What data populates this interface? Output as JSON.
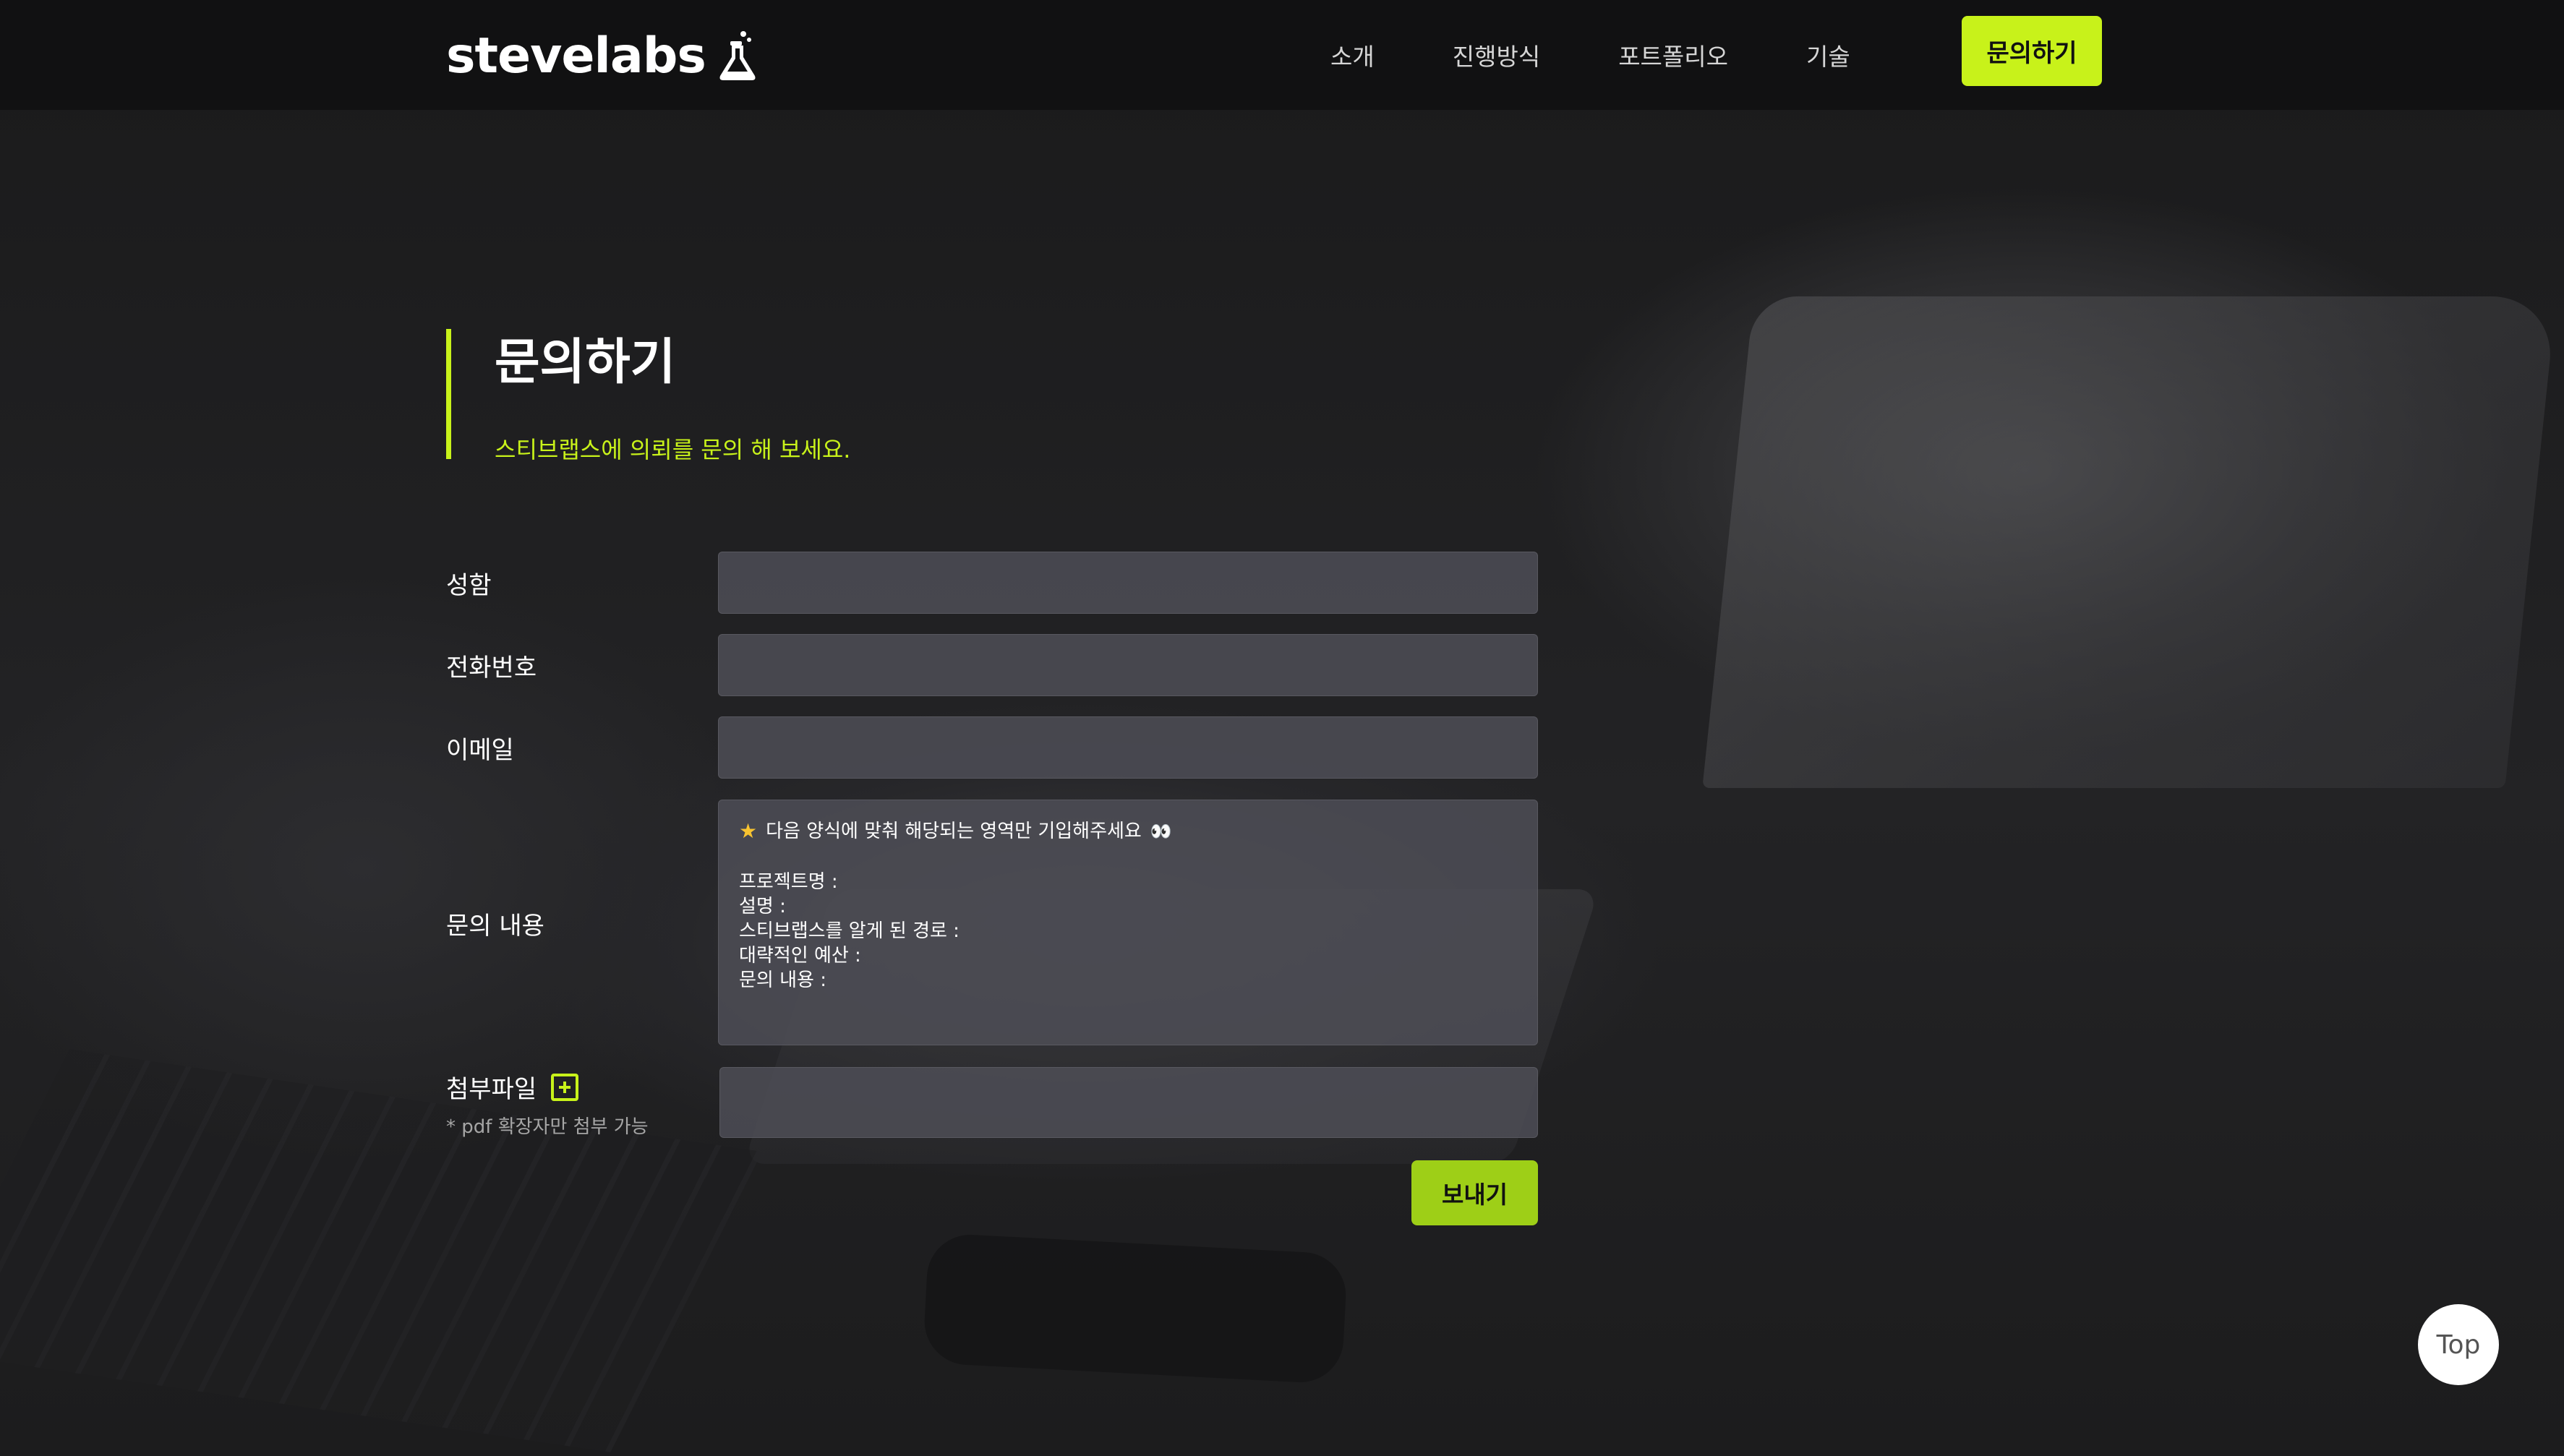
{
  "header": {
    "logo_text": "stevelabs",
    "logo_icon": "flask-icon",
    "nav": [
      "소개",
      "진행방식",
      "포트폴리오",
      "기술"
    ],
    "cta_label": "문의하기"
  },
  "hero": {
    "title": "문의하기",
    "subtitle": "스티브랩스에 의뢰를 문의 해 보세요."
  },
  "form": {
    "name_label": "성함",
    "phone_label": "전화번호",
    "email_label": "이메일",
    "content_label": "문의 내용",
    "content_template": {
      "heading": "다음 양식에 맞춰 해당되는 영역만 기입해주세요",
      "lines": [
        "프로젝트명 :",
        "설명 :",
        "스티브랩스를 알게 된 경로 :",
        "대략적인 예산 :",
        "문의 내용 :"
      ]
    },
    "file_label": "첨부파일",
    "file_note": "* pdf 확장자만 첨부 가능",
    "submit_label": "보내기"
  },
  "top_button_label": "Top",
  "colors": {
    "accent": "#c8f21a",
    "submit": "#9ecf17",
    "header_bg": "#111112"
  }
}
